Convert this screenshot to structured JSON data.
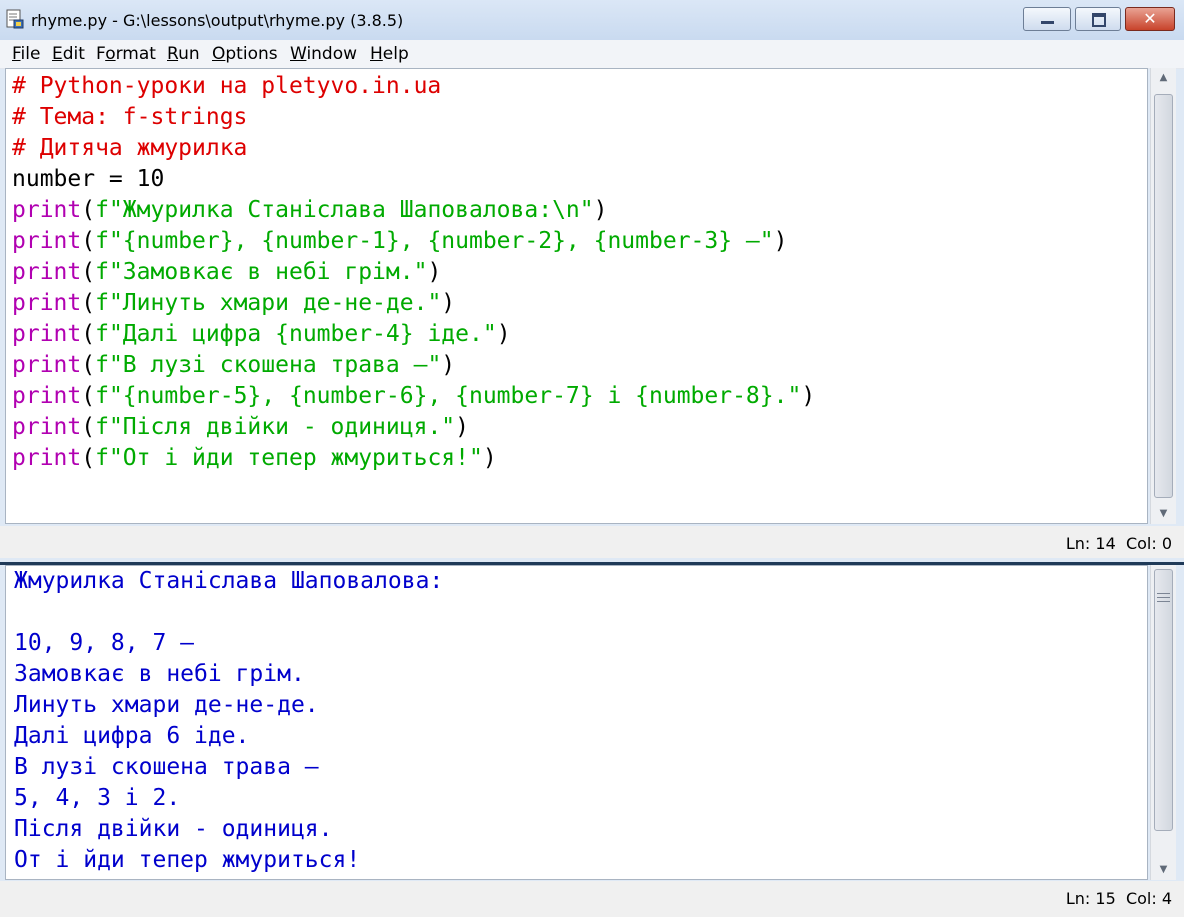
{
  "window": {
    "title": "rhyme.py - G:\\lessons\\output\\rhyme.py (3.8.5)",
    "close_glyph": "✕"
  },
  "menu": [
    {
      "accel": "F",
      "rest": "ile"
    },
    {
      "accel": "E",
      "rest": "dit"
    },
    {
      "pre": "F",
      "accel": "o",
      "rest": "rmat"
    },
    {
      "accel": "R",
      "rest": "un"
    },
    {
      "accel": "O",
      "rest": "ptions"
    },
    {
      "accel": "W",
      "rest": "indow"
    },
    {
      "accel": "H",
      "rest": "elp"
    }
  ],
  "editor": {
    "lines": [
      [
        {
          "t": "# Python-уроки на pletyvo.in.ua",
          "c": "comment"
        }
      ],
      [
        {
          "t": "# Тема: f-strings",
          "c": "comment"
        }
      ],
      [
        {
          "t": "# Дитяча жмурилка",
          "c": "comment"
        }
      ],
      [
        {
          "t": "number = 10",
          "c": "def"
        }
      ],
      [
        {
          "t": "print",
          "c": "kw"
        },
        {
          "t": "(",
          "c": "def"
        },
        {
          "t": "f\"Жмурилка Станіслава Шаповалова:\\n\"",
          "c": "str"
        },
        {
          "t": ")",
          "c": "def"
        }
      ],
      [
        {
          "t": "print",
          "c": "kw"
        },
        {
          "t": "(",
          "c": "def"
        },
        {
          "t": "f\"{number}, {number-1}, {number-2}, {number-3} –\"",
          "c": "str"
        },
        {
          "t": ")",
          "c": "def"
        }
      ],
      [
        {
          "t": "print",
          "c": "kw"
        },
        {
          "t": "(",
          "c": "def"
        },
        {
          "t": "f\"Замовкає в небі грім.\"",
          "c": "str"
        },
        {
          "t": ")",
          "c": "def"
        }
      ],
      [
        {
          "t": "print",
          "c": "kw"
        },
        {
          "t": "(",
          "c": "def"
        },
        {
          "t": "f\"Линуть хмари де-не-де.\"",
          "c": "str"
        },
        {
          "t": ")",
          "c": "def"
        }
      ],
      [
        {
          "t": "print",
          "c": "kw"
        },
        {
          "t": "(",
          "c": "def"
        },
        {
          "t": "f\"Далі цифра {number-4} іде.\"",
          "c": "str"
        },
        {
          "t": ")",
          "c": "def"
        }
      ],
      [
        {
          "t": "print",
          "c": "kw"
        },
        {
          "t": "(",
          "c": "def"
        },
        {
          "t": "f\"В лузі скошена трава –\"",
          "c": "str"
        },
        {
          "t": ")",
          "c": "def"
        }
      ],
      [
        {
          "t": "print",
          "c": "kw"
        },
        {
          "t": "(",
          "c": "def"
        },
        {
          "t": "f\"{number-5}, {number-6}, {number-7} і {number-8}.\"",
          "c": "str"
        },
        {
          "t": ")",
          "c": "def"
        }
      ],
      [
        {
          "t": "print",
          "c": "kw"
        },
        {
          "t": "(",
          "c": "def"
        },
        {
          "t": "f\"Після двійки - одиниця.\"",
          "c": "str"
        },
        {
          "t": ")",
          "c": "def"
        }
      ],
      [
        {
          "t": "print",
          "c": "kw"
        },
        {
          "t": "(",
          "c": "def"
        },
        {
          "t": "f\"От і йди тепер жмуриться!\"",
          "c": "str"
        },
        {
          "t": ")",
          "c": "def"
        }
      ]
    ],
    "status": "Ln: 14  Col: 0"
  },
  "shell": {
    "lines": [
      "Жмурилка Станіслава Шаповалова:",
      "",
      "10, 9, 8, 7 –",
      "Замовкає в небі грім.",
      "Линуть хмари де-не-де.",
      "Далі цифра 6 іде.",
      "В лузі скошена трава –",
      "5, 4, 3 і 2.",
      "Після двійки - одиниця.",
      "От і йди тепер жмуриться!"
    ],
    "status": "Ln: 15  Col: 4"
  },
  "colors": {
    "comment": "#dd0000",
    "keyword": "#b100b1",
    "string": "#00aa00",
    "output": "#0000cc"
  },
  "icons": [
    "python-file-icon",
    "minimize-icon",
    "maximize-icon",
    "close-icon",
    "scroll-up-icon",
    "scroll-down-icon"
  ]
}
